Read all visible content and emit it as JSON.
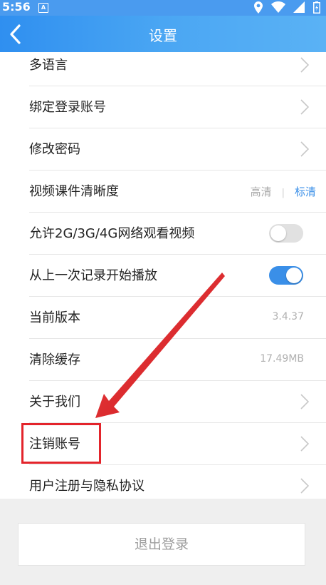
{
  "status_bar": {
    "time": "5:56",
    "notification_icon": "A",
    "icons": [
      "location-icon",
      "wifi-icon",
      "signal-icon",
      "battery-charging-icon"
    ]
  },
  "header": {
    "title": "设置",
    "back_icon": "chevron-left-icon"
  },
  "settings": {
    "language": "多语言",
    "bind_account": "绑定登录账号",
    "change_password": "修改密码",
    "video_quality": {
      "label": "视频课件清晰度",
      "options": [
        "高清",
        "标清"
      ],
      "separator": "|",
      "selected": "标清"
    },
    "allow_mobile_network": {
      "label": "允许2G/3G/4G网络观看视频",
      "enabled": false
    },
    "resume_playback": {
      "label": "从上一次记录开始播放",
      "enabled": true
    },
    "current_version": {
      "label": "当前版本",
      "value": "3.4.37"
    },
    "clear_cache": {
      "label": "清除缓存",
      "value": "17.49MB"
    },
    "about_us": "关于我们",
    "cancel_account": "注销账号",
    "privacy_agreement": "用户注册与隐私协议"
  },
  "logout": {
    "label": "退出登录"
  },
  "colors": {
    "accent": "#3a8fe8",
    "header_start": "#2f8ff0",
    "header_end": "#5ab2f5",
    "annotation": "#e3242b"
  }
}
